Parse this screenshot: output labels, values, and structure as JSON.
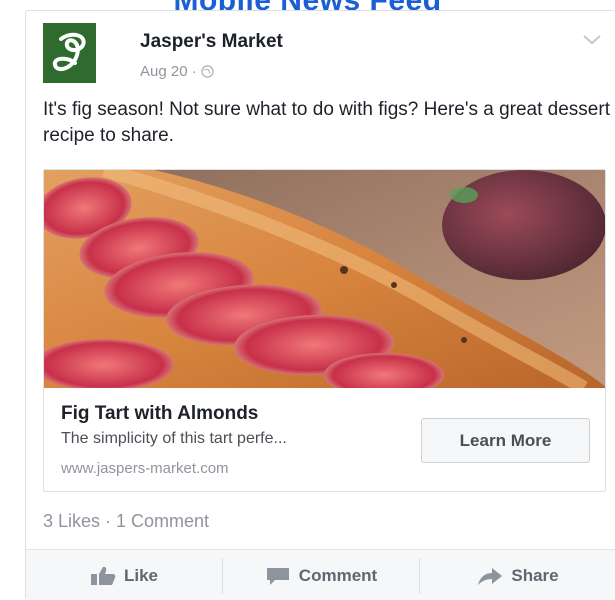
{
  "banner": {
    "title": "Mobile News Feed"
  },
  "post": {
    "page_name": "Jasper's Market",
    "date": "Aug 20 ·",
    "text": "It's fig season! Not sure what to do with figs? Here's a great dessert recipe to share.",
    "avatar_letter": "J",
    "avatar_color": "#2f6b2f"
  },
  "link": {
    "title": "Fig Tart with Almonds",
    "description": "The simplicity of this tart perfe...",
    "url": "www.jaspers-market.com",
    "button_label": "Learn More",
    "image_subject": "fig tart with sliced figs"
  },
  "engagement": {
    "summary": "3 Likes · 1 Comment"
  },
  "actions": [
    {
      "label": "Like",
      "icon": "thumbs-up-icon"
    },
    {
      "label": "Comment",
      "icon": "comment-icon"
    },
    {
      "label": "Share",
      "icon": "share-arrow-icon"
    }
  ],
  "colors": {
    "banner": "#1a5fd4",
    "secondary_text": "#90949c",
    "action_text": "#606770"
  }
}
